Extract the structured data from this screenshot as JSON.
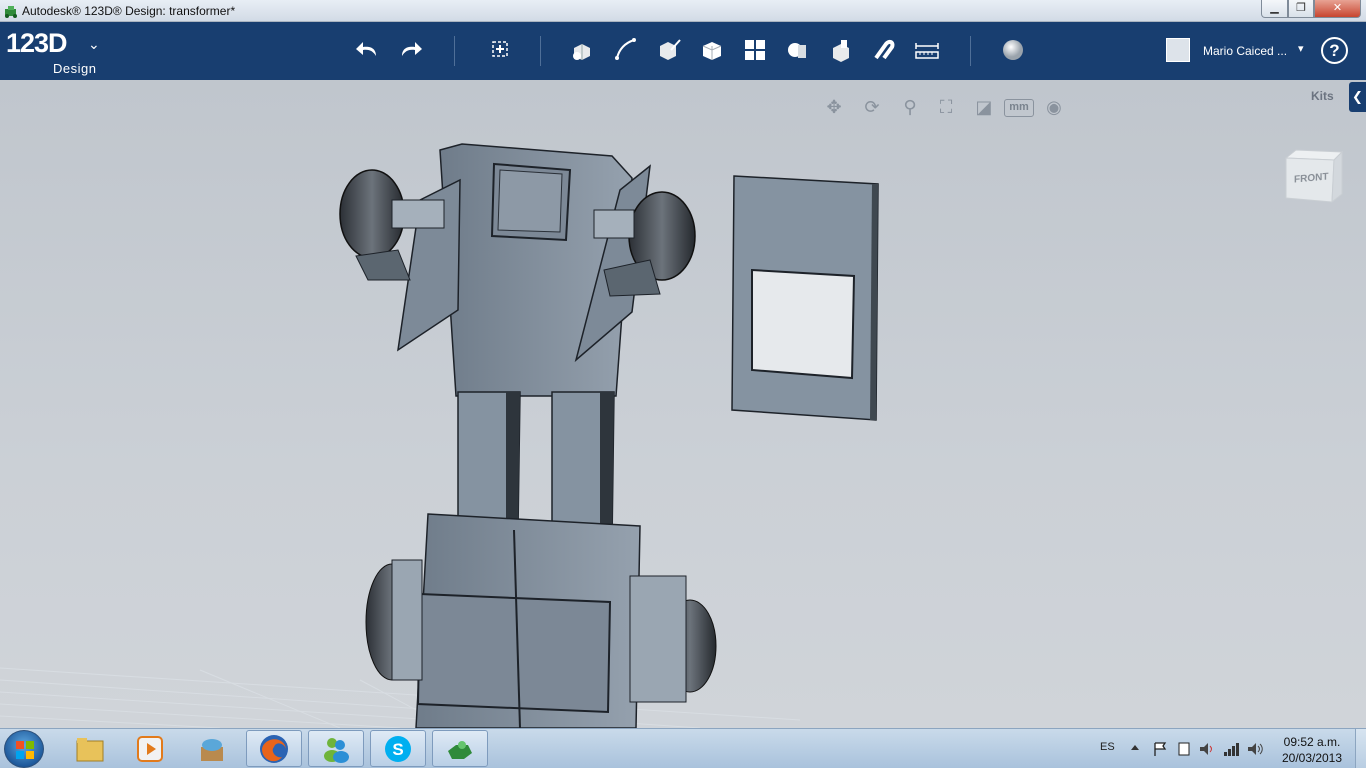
{
  "window": {
    "title": "Autodesk® 123D® Design: transformer*",
    "min_label": "▁",
    "max_label": "❐",
    "close_label": "✕"
  },
  "app": {
    "logo_number": "123D",
    "logo_sub": "Design",
    "toolbar": {
      "undo": "undo-icon",
      "redo": "redo-icon",
      "transform": "transform-icon",
      "primitives": "primitives-icon",
      "sketch": "sketch-icon",
      "construct": "construct-icon",
      "modify": "modify-icon",
      "pattern": "pattern-icon",
      "grouping": "grouping-icon",
      "combine": "combine-icon",
      "snap": "snap-icon",
      "measure": "measure-icon",
      "material": "material-icon"
    },
    "user": {
      "name": "Mario Caiced ...",
      "caret": "▾"
    },
    "help_label": "?"
  },
  "viewport": {
    "nav": [
      "pan-icon",
      "orbit-icon",
      "zoom-icon",
      "fit-icon",
      "view-style-icon",
      "units-icon",
      "visibility-icon"
    ],
    "units_label": "mm",
    "kits_label": "Kits",
    "kits_tab": "❮",
    "viewcube_label": "FRONT"
  },
  "taskbar": {
    "apps": [
      "explorer",
      "media-player",
      "archive",
      "firefox",
      "messenger",
      "skype",
      "123d-design"
    ],
    "language": "ES",
    "time": "09:52 a.m.",
    "date": "20/03/2013"
  }
}
